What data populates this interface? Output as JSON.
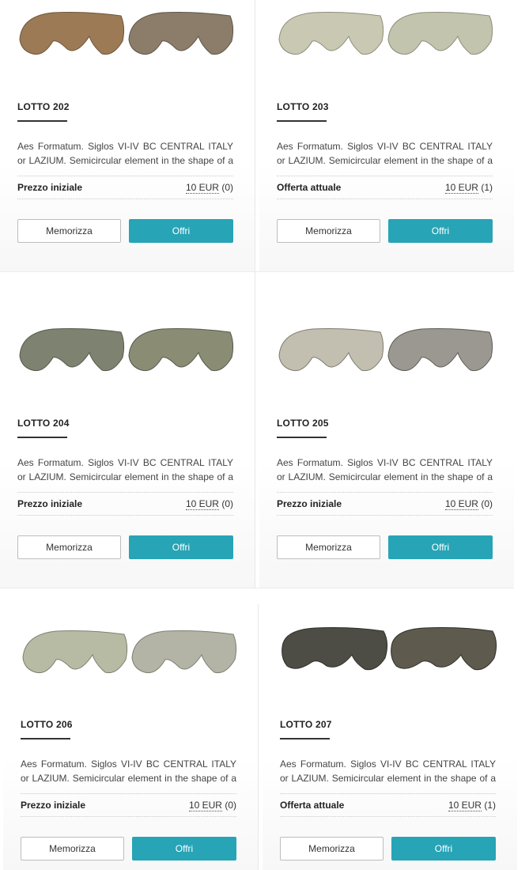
{
  "buttons": {
    "memorize": "Memorizza",
    "bid": "Offri"
  },
  "description": [
    "Aes Formatum. Siglos VI-IV BC CENTRAL ITALY",
    "or LAZIUM. Semicircular element in the shape of a"
  ],
  "lots": [
    {
      "title": "LOTTO 202",
      "price_label": "Prezzo iniziale",
      "amount": "10 EUR",
      "bids": "(0)",
      "color": "#9b7a55"
    },
    {
      "title": "LOTTO 203",
      "price_label": "Offerta attuale",
      "amount": "10 EUR",
      "bids": "(1)",
      "color": "#c9c9b3"
    },
    {
      "title": "LOTTO 204",
      "price_label": "Prezzo iniziale",
      "amount": "10 EUR",
      "bids": "(0)",
      "color": "#7d8370"
    },
    {
      "title": "LOTTO 205",
      "price_label": "Prezzo iniziale",
      "amount": "10 EUR",
      "bids": "(0)",
      "color": "#b9b7a8"
    },
    {
      "title": "LOTTO 206",
      "price_label": "Prezzo iniziale",
      "amount": "10 EUR",
      "bids": "(0)",
      "color": "#b7bba3"
    },
    {
      "title": "LOTTO 207",
      "price_label": "Offerta attuale",
      "amount": "10 EUR",
      "bids": "(1)",
      "color": "#4d4c45"
    }
  ]
}
